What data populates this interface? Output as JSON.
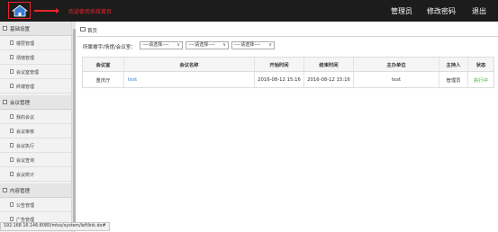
{
  "header": {
    "system_title": "欢迎使用系统首页",
    "nav": [
      "管理员",
      "修改密码",
      "退出"
    ]
  },
  "sidebar": {
    "groups": [
      {
        "label": "基础设置",
        "items": [
          "楼层管理",
          "场馆管理",
          "会议室管理",
          "终端管理"
        ]
      },
      {
        "label": "会议管理",
        "items": [
          "我的会议",
          "会议审核",
          "会议执行",
          "会议查询",
          "会议统计"
        ]
      },
      {
        "label": "内容管理",
        "items": [
          "公告管理",
          "广告管理"
        ]
      }
    ]
  },
  "breadcrumb": {
    "label": "首页"
  },
  "filter": {
    "label": "所属楼宇/场馆/会议室：",
    "selects": [
      "----请选择----",
      "----请选择----",
      "----请选择----"
    ]
  },
  "table": {
    "columns": [
      "会议室",
      "会议名称",
      "开始时间",
      "结束时间",
      "主办单位",
      "主持人",
      "状态"
    ],
    "rows": [
      [
        "重庆厅",
        "test",
        "2016-08-12 15:16",
        "2016-08-12 15:16",
        "test",
        "管理员",
        "执行中"
      ]
    ]
  },
  "colors": {
    "topbar": "#1c1c1c",
    "accent_red": "#e8262b",
    "link_blue": "#2a7fd4",
    "status_green": "#2eb82e"
  },
  "statusbar": {
    "url": "192.168.16.146:8080/mtss/system/leftlink.do#"
  }
}
